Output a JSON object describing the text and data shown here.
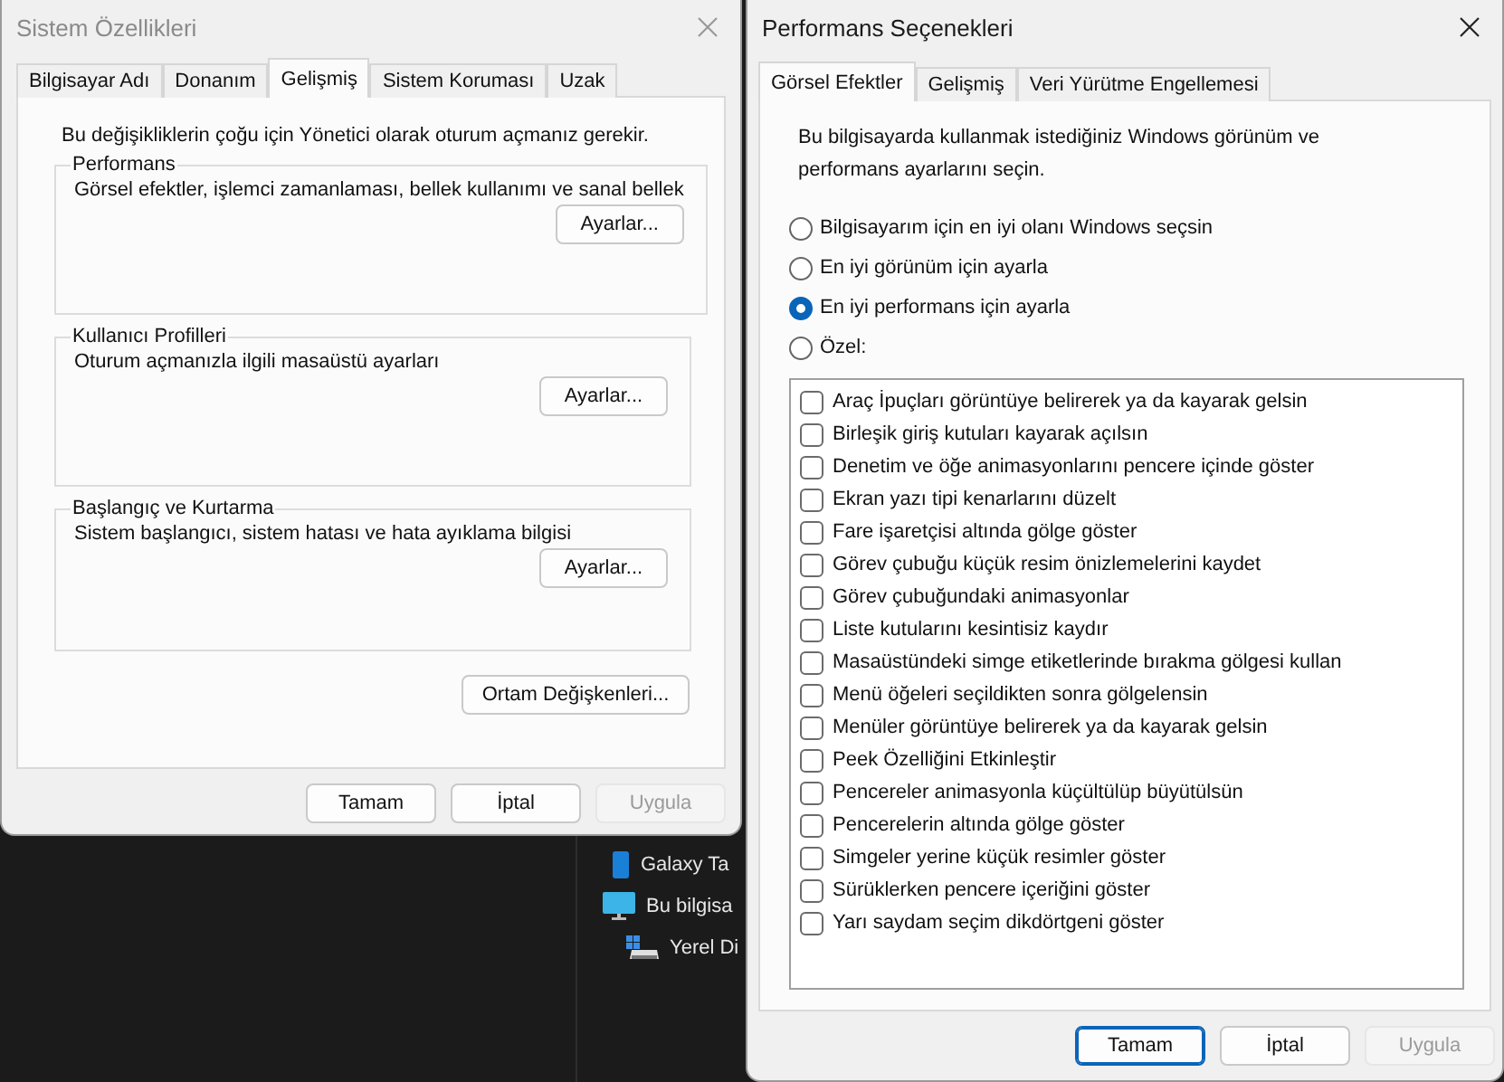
{
  "system_properties": {
    "title": "Sistem Özellikleri",
    "active": false,
    "tabs": [
      {
        "label": "Bilgisayar Adı",
        "selected": false
      },
      {
        "label": "Donanım",
        "selected": false
      },
      {
        "label": "Gelişmiş",
        "selected": true
      },
      {
        "label": "Sistem Koruması",
        "selected": false
      },
      {
        "label": "Uzak",
        "selected": false
      }
    ],
    "notice": "Bu değişikliklerin çoğu için Yönetici olarak oturum açmanız gerekir.",
    "groups": [
      {
        "title": "Performans",
        "description": "Görsel efektler, işlemci zamanlaması, bellek kullanımı ve sanal bellek",
        "button": "Ayarlar..."
      },
      {
        "title": "Kullanıcı Profilleri",
        "description": "Oturum açmanızla ilgili masaüstü ayarları",
        "button": "Ayarlar..."
      },
      {
        "title": "Başlangıç ve Kurtarma",
        "description": "Sistem başlangıcı, sistem hatası ve hata ayıklama bilgisi",
        "button": "Ayarlar..."
      }
    ],
    "env_button": "Ortam Değişkenleri...",
    "buttons": [
      {
        "label": "Tamam",
        "default": false,
        "disabled": false
      },
      {
        "label": "İptal",
        "default": false,
        "disabled": false
      },
      {
        "label": "Uygula",
        "default": false,
        "disabled": true
      }
    ]
  },
  "performance_options": {
    "title": "Performans Seçenekleri",
    "active": true,
    "tabs": [
      {
        "label": "Görsel Efektler",
        "selected": true
      },
      {
        "label": "Gelişmiş",
        "selected": false
      },
      {
        "label": "Veri Yürütme Engellemesi",
        "selected": false
      }
    ],
    "description": "Bu bilgisayarda kullanmak istediğiniz Windows görünüm ve performans ayarlarını seçin.",
    "options": [
      {
        "label": "Bilgisayarım için en iyi olanı Windows seçsin",
        "selected": false
      },
      {
        "label": "En iyi görünüm için ayarla",
        "selected": false
      },
      {
        "label": "En iyi performans için ayarla",
        "selected": true
      },
      {
        "label": "Özel:",
        "selected": false
      }
    ],
    "effects": [
      {
        "label": "Araç İpuçları görüntüye belirerek ya da kayarak gelsin",
        "checked": false
      },
      {
        "label": "Birleşik giriş kutuları kayarak açılsın",
        "checked": false
      },
      {
        "label": "Denetim ve öğe animasyonlarını pencere içinde göster",
        "checked": false
      },
      {
        "label": "Ekran yazı tipi kenarlarını düzelt",
        "checked": false
      },
      {
        "label": "Fare işaretçisi altında gölge göster",
        "checked": false
      },
      {
        "label": "Görev çubuğu küçük resim önizlemelerini kaydet",
        "checked": false
      },
      {
        "label": "Görev çubuğundaki animasyonlar",
        "checked": false
      },
      {
        "label": "Liste kutularını kesintisiz kaydır",
        "checked": false
      },
      {
        "label": "Masaüstündeki simge etiketlerinde bırakma gölgesi kullan",
        "checked": false
      },
      {
        "label": "Menü öğeleri seçildikten sonra gölgelensin",
        "checked": false
      },
      {
        "label": "Menüler görüntüye belirerek ya da kayarak gelsin",
        "checked": false
      },
      {
        "label": "Peek Özelliğini Etkinleştir",
        "checked": false
      },
      {
        "label": "Pencereler animasyonla küçültülüp büyütülsün",
        "checked": false
      },
      {
        "label": "Pencerelerin altında gölge göster",
        "checked": false
      },
      {
        "label": "Simgeler yerine küçük resimler göster",
        "checked": false
      },
      {
        "label": "Sürüklerken pencere içeriğini göster",
        "checked": false
      },
      {
        "label": "Yarı saydam seçim dikdörtgeni göster",
        "checked": false
      }
    ],
    "buttons": [
      {
        "label": "Tamam",
        "default": true,
        "disabled": false
      },
      {
        "label": "İptal",
        "default": false,
        "disabled": false
      },
      {
        "label": "Uygula",
        "default": false,
        "disabled": true
      }
    ]
  },
  "explorer_items": [
    {
      "kind": "tablet",
      "label": "Galaxy Ta"
    },
    {
      "kind": "computer",
      "label": "Bu bilgisa"
    },
    {
      "kind": "drive",
      "label": "Yerel Di"
    }
  ]
}
